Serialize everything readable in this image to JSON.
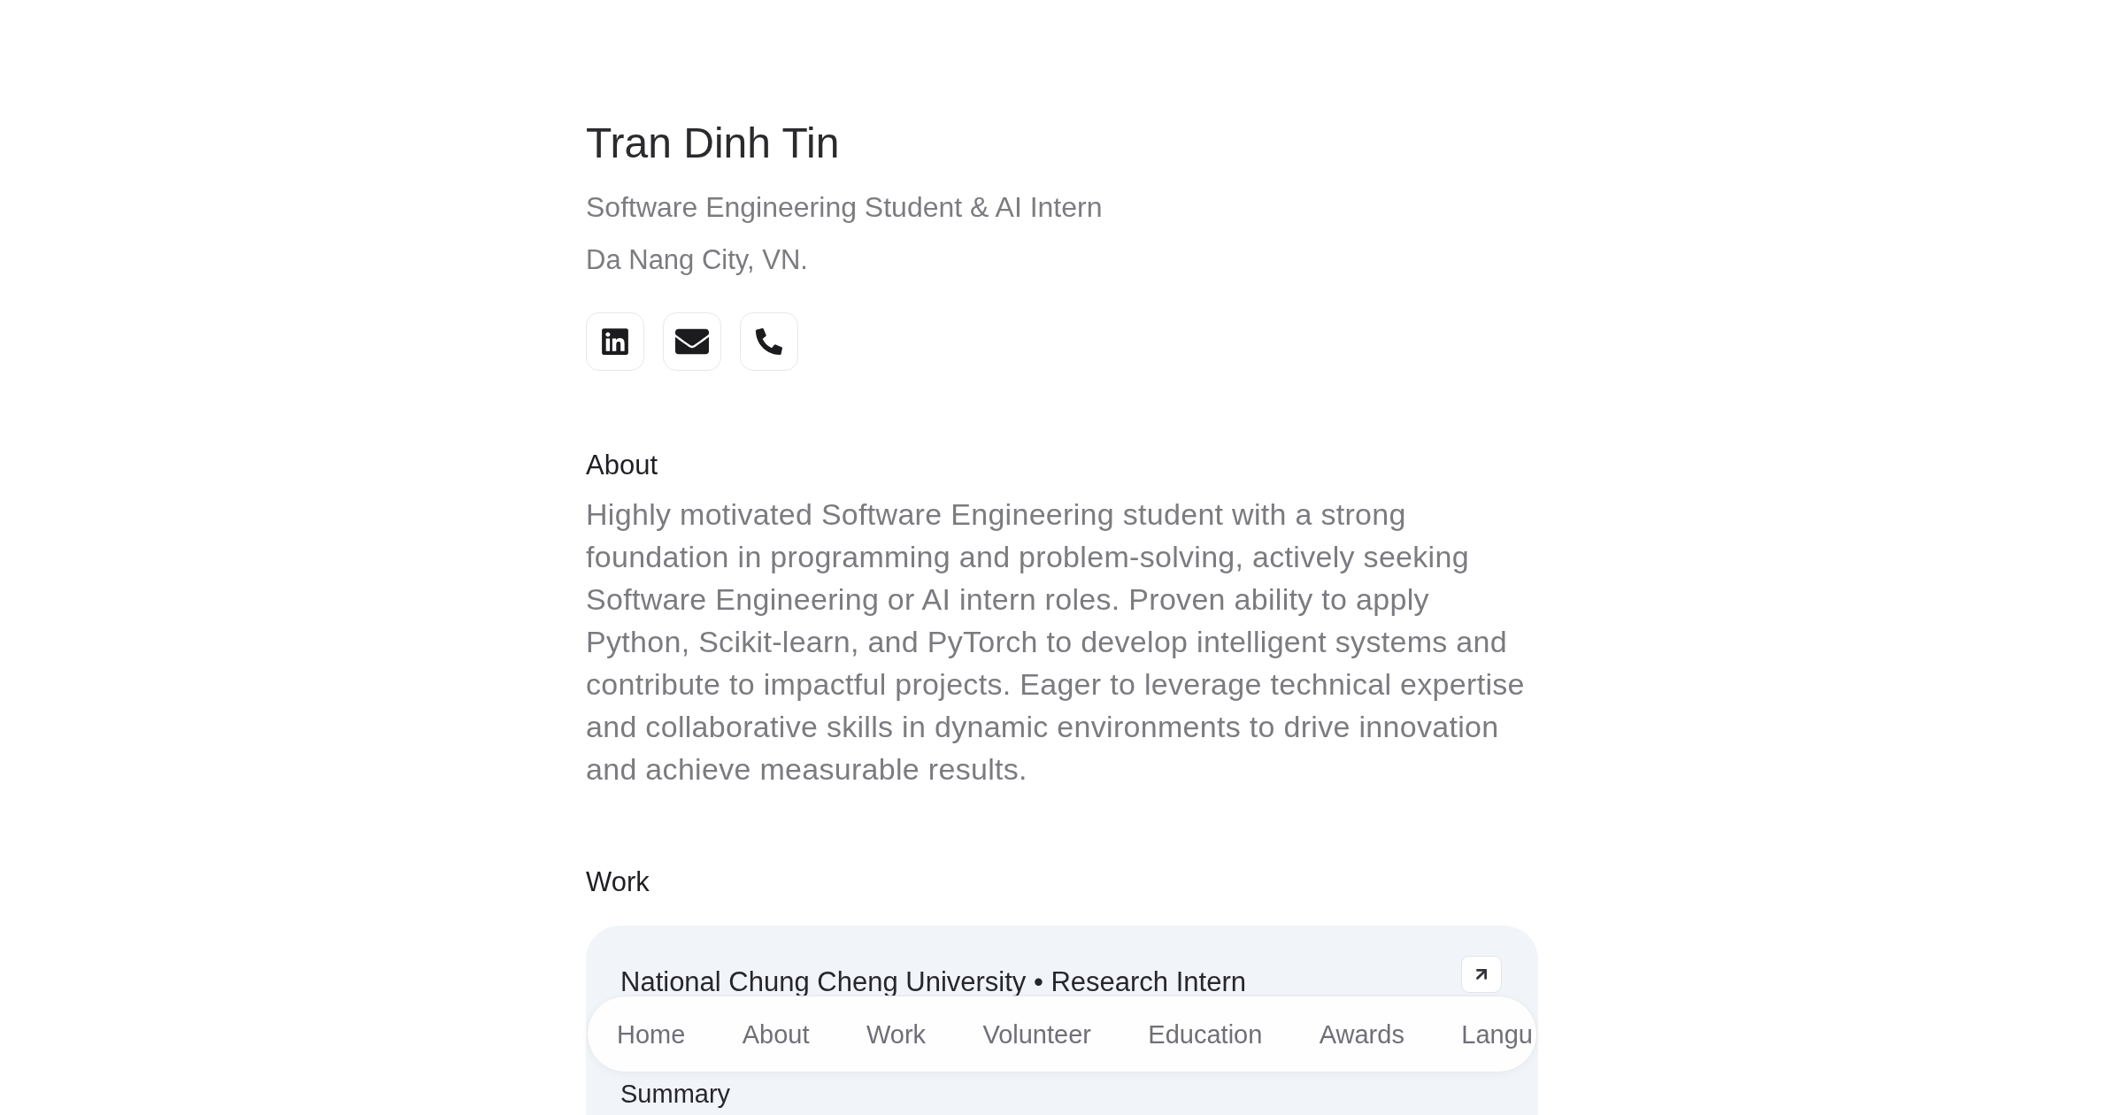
{
  "profile": {
    "name": "Tran Dinh Tin",
    "headline": "Software Engineering Student & AI Intern",
    "location": "Da Nang City, VN."
  },
  "contact_links": [
    {
      "kind": "linkedin"
    },
    {
      "kind": "email"
    },
    {
      "kind": "phone"
    }
  ],
  "about": {
    "heading": "About",
    "text": "Highly motivated Software Engineering student with a strong foundation in programming and problem-solving, actively seeking Software Engineering or AI intern roles. Proven ability to apply Python, Scikit-learn, and PyTorch to develop intelligent systems and contribute to impactful projects. Eager to leverage technical expertise and collaborative skills in dynamic environments to drive innovation and achieve measurable results."
  },
  "work": {
    "heading": "Work",
    "entries": [
      {
        "title": "National Chung Cheng University • Research Intern",
        "summary_label": "Summary"
      }
    ]
  },
  "nav": {
    "items": [
      {
        "label": "Home"
      },
      {
        "label": "About"
      },
      {
        "label": "Work"
      },
      {
        "label": "Volunteer"
      },
      {
        "label": "Education"
      },
      {
        "label": "Awards"
      },
      {
        "label": "Langu"
      }
    ]
  }
}
